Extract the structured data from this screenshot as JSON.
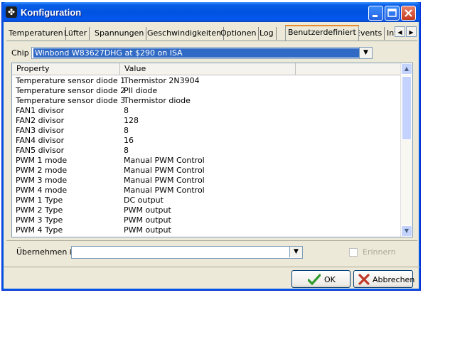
{
  "window": {
    "title": "Konfiguration"
  },
  "tabs": [
    "Temperaturen",
    "Lüfter",
    "Spannungen",
    "Geschwindigkeiten",
    "Optionen",
    "Log",
    "Benutzerdefiniert",
    "Events",
    "Int"
  ],
  "active_tab_index": 6,
  "chip": {
    "label": "Chip",
    "value": "Winbond W83627DHG at $290 on ISA"
  },
  "grid": {
    "headers": [
      "Property",
      "Value"
    ],
    "rows": [
      {
        "property": "Temperature sensor diode 1",
        "value": "Thermistor 2N3904"
      },
      {
        "property": "Temperature sensor diode 2",
        "value": "PII diode"
      },
      {
        "property": "Temperature sensor diode 3",
        "value": "Thermistor diode"
      },
      {
        "property": "FAN1 divisor",
        "value": "8"
      },
      {
        "property": "FAN2 divisor",
        "value": "128"
      },
      {
        "property": "FAN3 divisor",
        "value": "8"
      },
      {
        "property": "FAN4 divisor",
        "value": "16"
      },
      {
        "property": "FAN5 divisor",
        "value": "8"
      },
      {
        "property": "PWM 1 mode",
        "value": "Manual PWM Control"
      },
      {
        "property": "PWM 2 mode",
        "value": "Manual PWM Control"
      },
      {
        "property": "PWM 3 mode",
        "value": "Manual PWM Control"
      },
      {
        "property": "PWM 4 mode",
        "value": "Manual PWM Control"
      },
      {
        "property": "PWM 1 Type",
        "value": "DC output"
      },
      {
        "property": "PWM 2 Type",
        "value": "PWM output"
      },
      {
        "property": "PWM 3 Type",
        "value": "PWM output"
      },
      {
        "property": "PWM 4 Type",
        "value": "PWM output"
      }
    ]
  },
  "apply": {
    "label": "Übernehmen in",
    "value": ""
  },
  "remember": {
    "label": "Erinnern",
    "checked": false,
    "enabled": false
  },
  "buttons": {
    "ok": "OK",
    "cancel": "Abbrechen"
  },
  "icons": {
    "app": "fan-icon",
    "minimize": "minimize-icon",
    "maximize": "maximize-icon",
    "close": "close-icon",
    "ok": "checkmark-icon",
    "cancel": "x-icon"
  },
  "colors": {
    "titlebar": "#0053e0",
    "selection": "#316ac5",
    "tab_highlight": "#e68b2c",
    "ok_check": "#2e9a2e",
    "cancel_x": "#c0392b"
  }
}
